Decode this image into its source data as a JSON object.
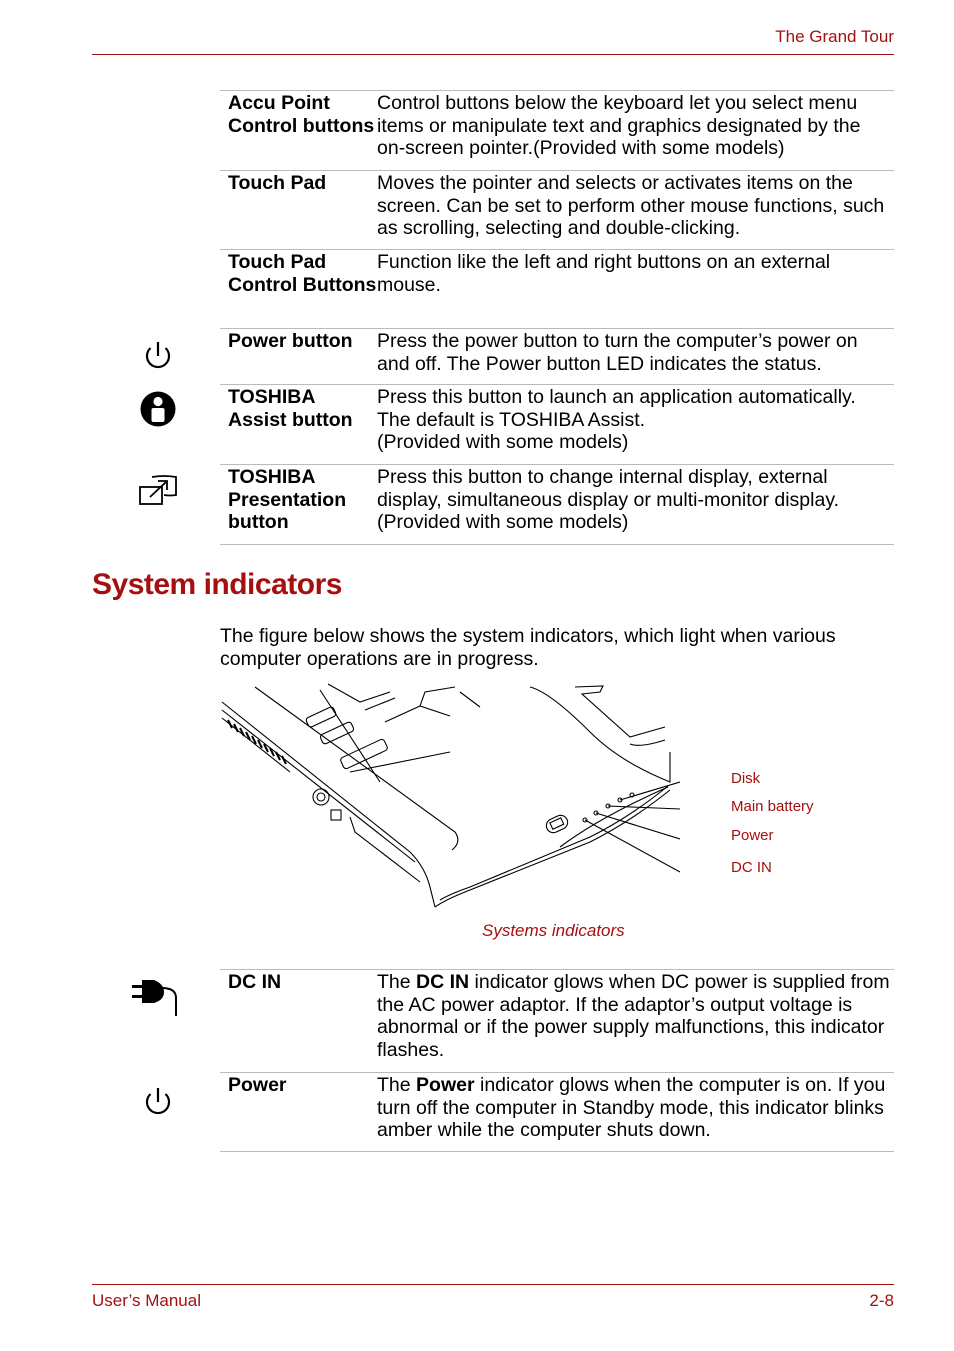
{
  "header": {
    "title": "The Grand Tour"
  },
  "footer": {
    "left": "User’s Manual",
    "right": "2-8"
  },
  "table1": {
    "rows": [
      {
        "term": "Accu Point Control buttons",
        "desc": "Control buttons below the keyboard let you select menu items or manipulate text and graphics designated by the on-screen pointer.(Provided with some models)",
        "icon": ""
      },
      {
        "term": "Touch Pad",
        "desc": "Moves the pointer and selects or activates items on the screen. Can be set to perform other mouse functions, such as scrolling, selecting and double-clicking.",
        "icon": ""
      },
      {
        "term": "Touch Pad Control Buttons",
        "desc": "Function like the left and right buttons on an external mouse.",
        "icon": ""
      },
      {
        "term": "Power button",
        "desc": "Press the power button to turn the computer’s power on and off. The Power button LED indicates the status.",
        "icon": "power-icon"
      },
      {
        "term": "TOSHIBA Assist button",
        "desc_lines": [
          "Press this button to launch an application automatically.",
          "The default is TOSHIBA Assist.",
          "(Provided with some models)"
        ],
        "icon": "assist-icon"
      },
      {
        "term": "TOSHIBA Presentation button",
        "desc_lines": [
          "Press this button to change internal display, external display, simultaneous display or multi-monitor display.",
          "(Provided with some models)"
        ],
        "icon": "presentation-icon"
      }
    ]
  },
  "section": {
    "title": "System indicators",
    "intro": "The figure below shows the system indicators, which light when various computer operations are in progress."
  },
  "figure": {
    "labels": [
      "Disk",
      "Main battery",
      "Power",
      "DC IN"
    ],
    "caption": "Systems indicators"
  },
  "table2": {
    "rows": [
      {
        "term": "DC IN",
        "desc_pre": "The ",
        "desc_bold": "DC IN",
        "desc_post": " indicator glows when DC power is supplied from  the AC power adaptor. If the adaptor’s output voltage is abnormal or if the power supply malfunctions, this indicator flashes.",
        "icon": "dc-in-plug-icon"
      },
      {
        "term": "Power",
        "desc_pre": "The ",
        "desc_bold": "Power",
        "desc_post": " indicator glows when the computer is on. If you turn off the computer in Standby mode, this indicator blinks amber while the computer shuts down.",
        "icon": "power-icon"
      }
    ]
  },
  "colors": {
    "accent": "#a50f0f",
    "rule": "#bbbbbb"
  }
}
